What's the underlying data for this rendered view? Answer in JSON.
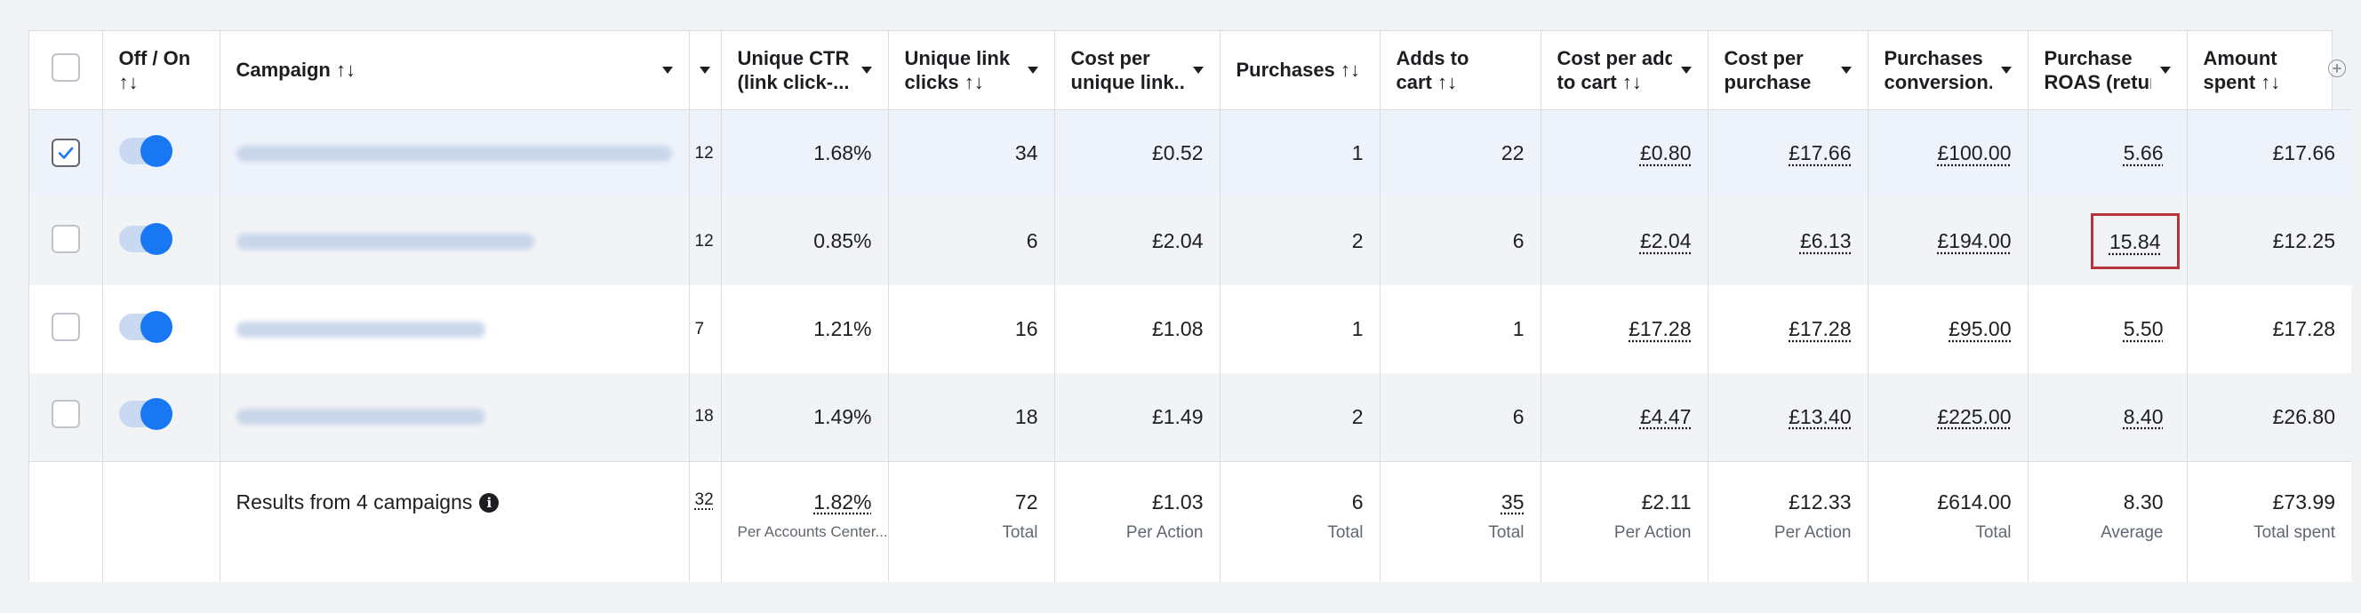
{
  "headers": {
    "off_on": "Off / On",
    "off_on_sort": "↑↓",
    "campaign": "Campaign ↑↓",
    "unique_ctr_1": "Unique CTR",
    "unique_ctr_2": "(link click-...",
    "unique_link_1": "Unique link",
    "unique_link_2": "clicks ↑↓",
    "cost_unique_1": "Cost per",
    "cost_unique_2": "unique link...",
    "purchases": "Purchases ↑↓",
    "adds_1": "Adds to",
    "adds_2": "cart ↑↓",
    "cost_add_1": "Cost per add",
    "cost_add_2": "to cart ↑↓",
    "cost_purchase_1": "Cost per",
    "cost_purchase_2": "purchase",
    "purch_conv_1": "Purchases",
    "purch_conv_2": "conversion...",
    "roas_1": "Purchase",
    "roas_2": "ROAS (retur...",
    "amount_1": "Amount",
    "amount_2": "spent ↑↓"
  },
  "rows": [
    {
      "selected": true,
      "active": true,
      "col2": "12",
      "ctr": "1.68%",
      "clicks": "34",
      "cost_unique": "£0.52",
      "purchases": "1",
      "adds": "22",
      "cost_add": "£0.80",
      "cost_purchase": "£17.66",
      "purch_value": "£100.00",
      "roas": "5.66",
      "spent": "£17.66"
    },
    {
      "selected": false,
      "active": true,
      "col2": "12",
      "ctr": "0.85%",
      "clicks": "6",
      "cost_unique": "£2.04",
      "purchases": "2",
      "adds": "6",
      "cost_add": "£2.04",
      "cost_purchase": "£6.13",
      "purch_value": "£194.00",
      "roas": "15.84",
      "spent": "£12.25"
    },
    {
      "selected": false,
      "active": true,
      "col2": "7",
      "ctr": "1.21%",
      "clicks": "16",
      "cost_unique": "£1.08",
      "purchases": "1",
      "adds": "1",
      "cost_add": "£17.28",
      "cost_purchase": "£17.28",
      "purch_value": "£95.00",
      "roas": "5.50",
      "spent": "£17.28"
    },
    {
      "selected": false,
      "active": true,
      "col2": "18",
      "ctr": "1.49%",
      "clicks": "18",
      "cost_unique": "£1.49",
      "purchases": "2",
      "adds": "6",
      "cost_add": "£4.47",
      "cost_purchase": "£13.40",
      "purch_value": "£225.00",
      "roas": "8.40",
      "spent": "£26.80"
    }
  ],
  "summary": {
    "label": "Results from 4 campaigns",
    "col2": "32",
    "ctr": "1.82%",
    "ctr_sub": "Per Accounts Center...",
    "clicks": "72",
    "clicks_sub": "Total",
    "cost_unique": "£1.03",
    "cost_unique_sub": "Per Action",
    "purchases": "6",
    "purchases_sub": "Total",
    "adds": "35",
    "adds_sub": "Total",
    "cost_add": "£2.11",
    "cost_add_sub": "Per Action",
    "cost_purchase": "£12.33",
    "cost_purchase_sub": "Per Action",
    "purch_value": "£614.00",
    "purch_value_sub": "Total",
    "roas": "8.30",
    "roas_sub": "Average",
    "spent": "£73.99",
    "spent_sub": "Total spent"
  },
  "colors": {
    "accent": "#1877f2",
    "highlight_border": "#b4363b"
  }
}
